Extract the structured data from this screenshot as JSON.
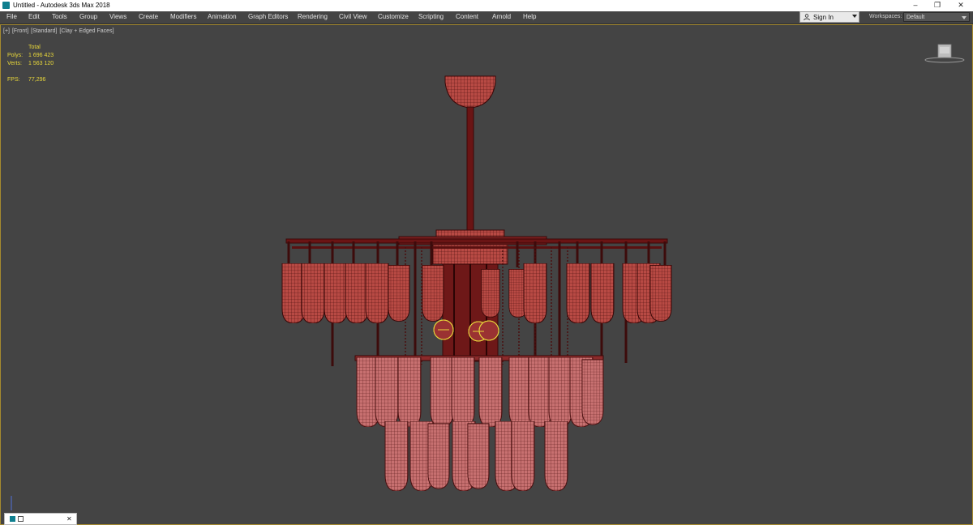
{
  "window": {
    "title": "Untitled - Autodesk 3ds Max 2018",
    "minimize": "–",
    "maximize": "❐",
    "close": "✕"
  },
  "menu": [
    "File",
    "Edit",
    "Tools",
    "Group",
    "Views",
    "Create",
    "Modifiers",
    "Animation",
    "Graph Editors",
    "Rendering",
    "Civil View",
    "Customize",
    "Scripting",
    "Content",
    "Arnold",
    "Help"
  ],
  "signin": {
    "label": "Sign In"
  },
  "workspaces": {
    "label": "Workspaces:",
    "value": "Default"
  },
  "viewport": {
    "labels": [
      "[+]",
      "[Front]",
      "[Standard]",
      "[Clay + Edged Faces]"
    ],
    "stats": {
      "header": "Total",
      "polys_label": "Polys:",
      "polys": "1 696 423",
      "verts_label": "Verts:",
      "verts": "1 563 120",
      "fps_label": "FPS:",
      "fps": "77,296"
    }
  },
  "colors": {
    "viewport_bg": "#444444",
    "mesh_fill": "#b84a44",
    "mesh_light": "#c77070",
    "mesh_edge": "#4a0d0d",
    "stats_text": "#e8d73a",
    "frame": "#a58a2f"
  },
  "icons": {
    "app": "3ds-max-icon",
    "user": "user-icon",
    "viewcube": "viewcube-icon"
  }
}
